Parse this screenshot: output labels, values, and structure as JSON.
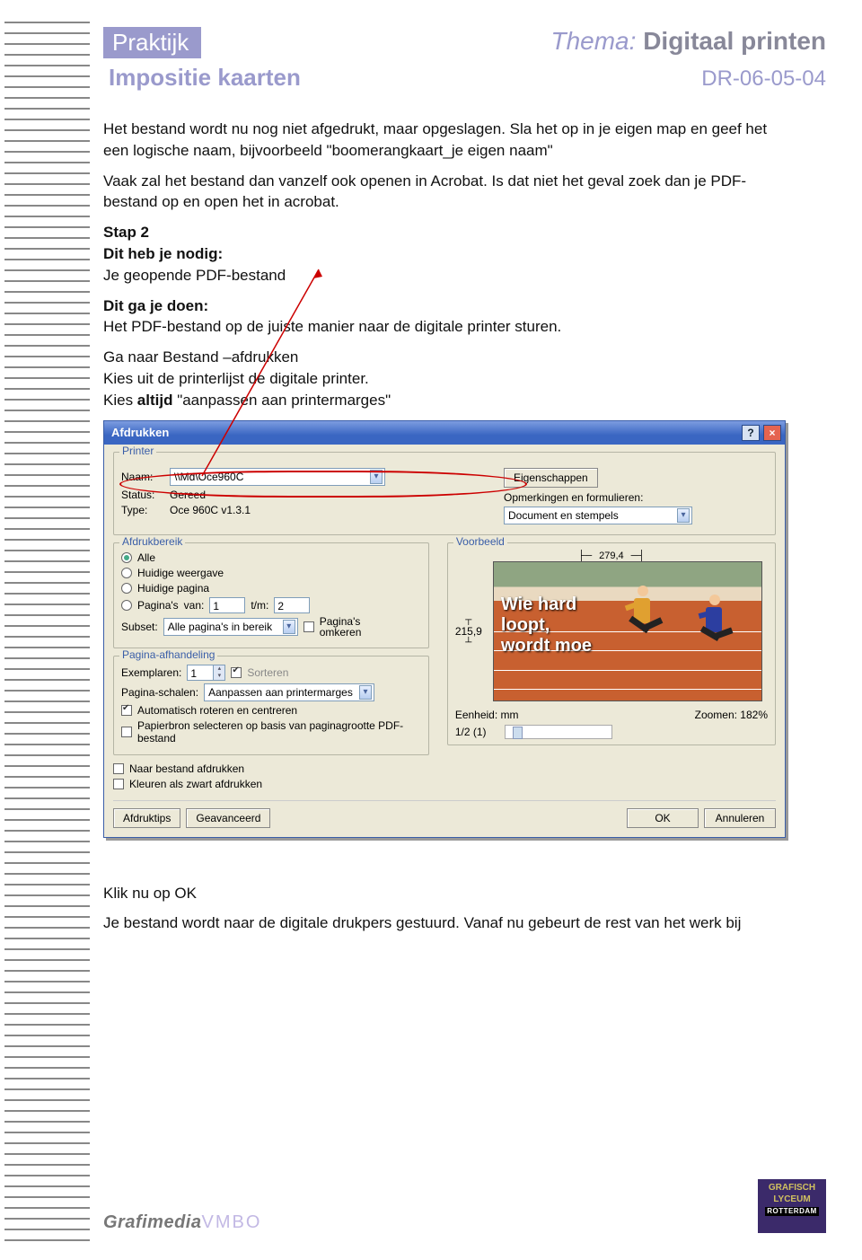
{
  "header": {
    "tag": "Praktijk",
    "thema_prefix": "Thema:",
    "thema_title": "Digitaal printen",
    "subtitle": "Impositie kaarten",
    "code": "DR-06-05-04"
  },
  "body": {
    "p1": "Het bestand wordt nu nog niet afgedrukt, maar opgeslagen. Sla het op in  je eigen map en geef het een logische naam, bijvoorbeeld  \"boomerangkaart_je eigen naam\"",
    "p2": "Vaak zal het bestand dan vanzelf ook openen in Acrobat. Is dat niet het geval zoek dan je PDF-bestand op en open het in acrobat.",
    "stap2": "Stap 2",
    "ditheb": "Dit heb je nodig:",
    "ditheb_rest": "Je geopende PDF-bestand",
    "gajedoen": "Dit ga je doen:",
    "gajedoen_rest": "Het PDF-bestand op de juiste manier naar de digitale printer sturen.",
    "p3a": "Ga naar Bestand –afdrukken",
    "p3b": "Kies uit de printerlijst de digitale printer.",
    "p3c_a": "Kies ",
    "p3c_b": "altijd",
    "p3c_c": " \"aanpassen aan printermarges\"",
    "klik": "Klik nu op OK",
    "final": "Je bestand wordt naar de digitale drukpers gestuurd. Vanaf nu gebeurt de rest van het werk bij"
  },
  "dialog": {
    "title": "Afdrukken",
    "help": "?",
    "close": "×",
    "printer": {
      "group": "Printer",
      "naam_lbl": "Naam:",
      "naam_val": "\\\\Md\\Oce960C",
      "eigenschappen": "Eigenschappen",
      "status_lbl": "Status:",
      "status_val": "Gereed",
      "type_lbl": "Type:",
      "type_val": "Oce 960C v1.3.1",
      "opm_lbl": "Opmerkingen en formulieren:",
      "opm_val": "Document en stempels"
    },
    "bereik": {
      "group": "Afdrukbereik",
      "alle": "Alle",
      "huidige_weergave": "Huidige weergave",
      "huidige_pagina": "Huidige pagina",
      "paginas": "Pagina's",
      "van": "van:",
      "van_val": "1",
      "tm": "t/m:",
      "tm_val": "2",
      "subset_lbl": "Subset:",
      "subset_val": "Alle pagina's in bereik",
      "omkeren": "Pagina's\nomkeren"
    },
    "afhandeling": {
      "group": "Pagina-afhandeling",
      "exemplaren_lbl": "Exemplaren:",
      "exemplaren_val": "1",
      "sorteren": "Sorteren",
      "schalen_lbl": "Pagina-schalen:",
      "schalen_val": "Aanpassen aan printermarges",
      "auto_rot": "Automatisch roteren en centreren",
      "papierbron": "Papierbron selecteren op basis van paginagrootte PDF-bestand"
    },
    "lower": {
      "naar_bestand": "Naar bestand afdrukken",
      "kleuren_zwart": "Kleuren als zwart afdrukken"
    },
    "voorbeeld": {
      "group": "Voorbeeld",
      "width": "279,4",
      "height": "215,9",
      "eenheid_lbl": "Eenheid: mm",
      "zoom_lbl": "Zoomen: 182%",
      "page_ind": "1/2 (1)"
    },
    "preview_text": {
      "l1": "Wie hard",
      "l2": "loopt,",
      "l3": "wordt moe"
    },
    "buttons": {
      "afdruktips": "Afdruktips",
      "geavanceerd": "Geavanceerd",
      "ok": "OK",
      "annuleren": "Annuleren"
    }
  },
  "footer": {
    "brand1": "Grafimedia",
    "brand2": "VMBO",
    "logo_l1": "GRAFISCH",
    "logo_l2": "LYCEUM",
    "logo_l3": "ROTTERDAM"
  }
}
